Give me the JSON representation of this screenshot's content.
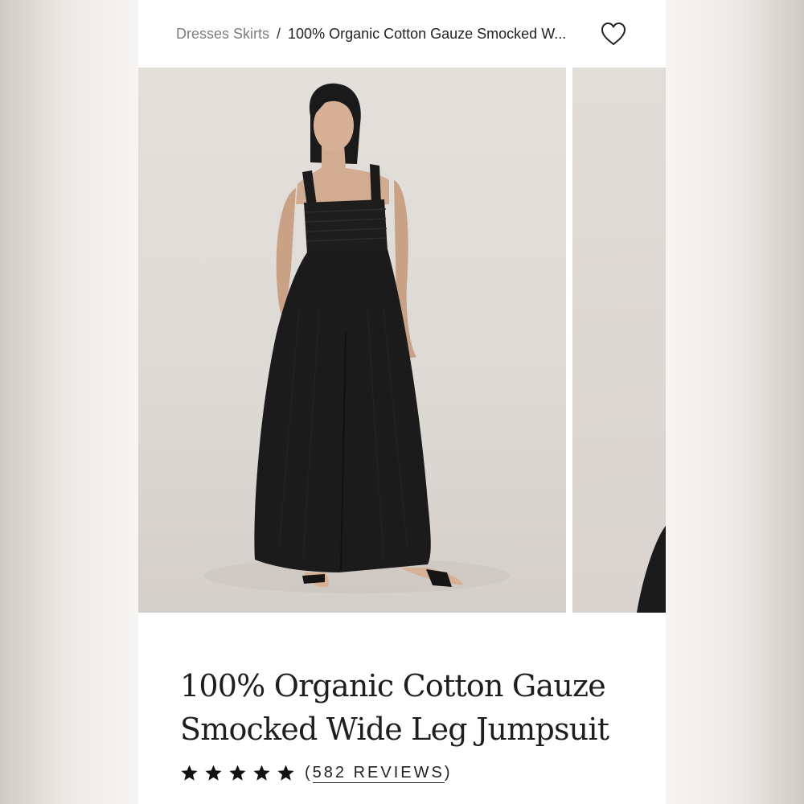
{
  "breadcrumb": {
    "parent": "Dresses Skirts",
    "separator": "/",
    "current": "100% Organic Cotton Gauze Smocked W..."
  },
  "header": {
    "favorite_icon": "heart-icon"
  },
  "gallery": {
    "main_image": "product photo: model wearing black smocked wide leg jumpsuit",
    "next_image": "product photo: partial view"
  },
  "product": {
    "title_line1": "100% Organic Cotton Gauze",
    "title_line2": "Smocked Wide Leg Jumpsuit",
    "rating_stars": 5,
    "reviews_open": "(",
    "reviews_label": "582 REVIEWS",
    "reviews_close": ")"
  },
  "colors": {
    "text": "#1e1e1e",
    "muted": "#7d7d7d",
    "garment": "#1b1b1b"
  }
}
